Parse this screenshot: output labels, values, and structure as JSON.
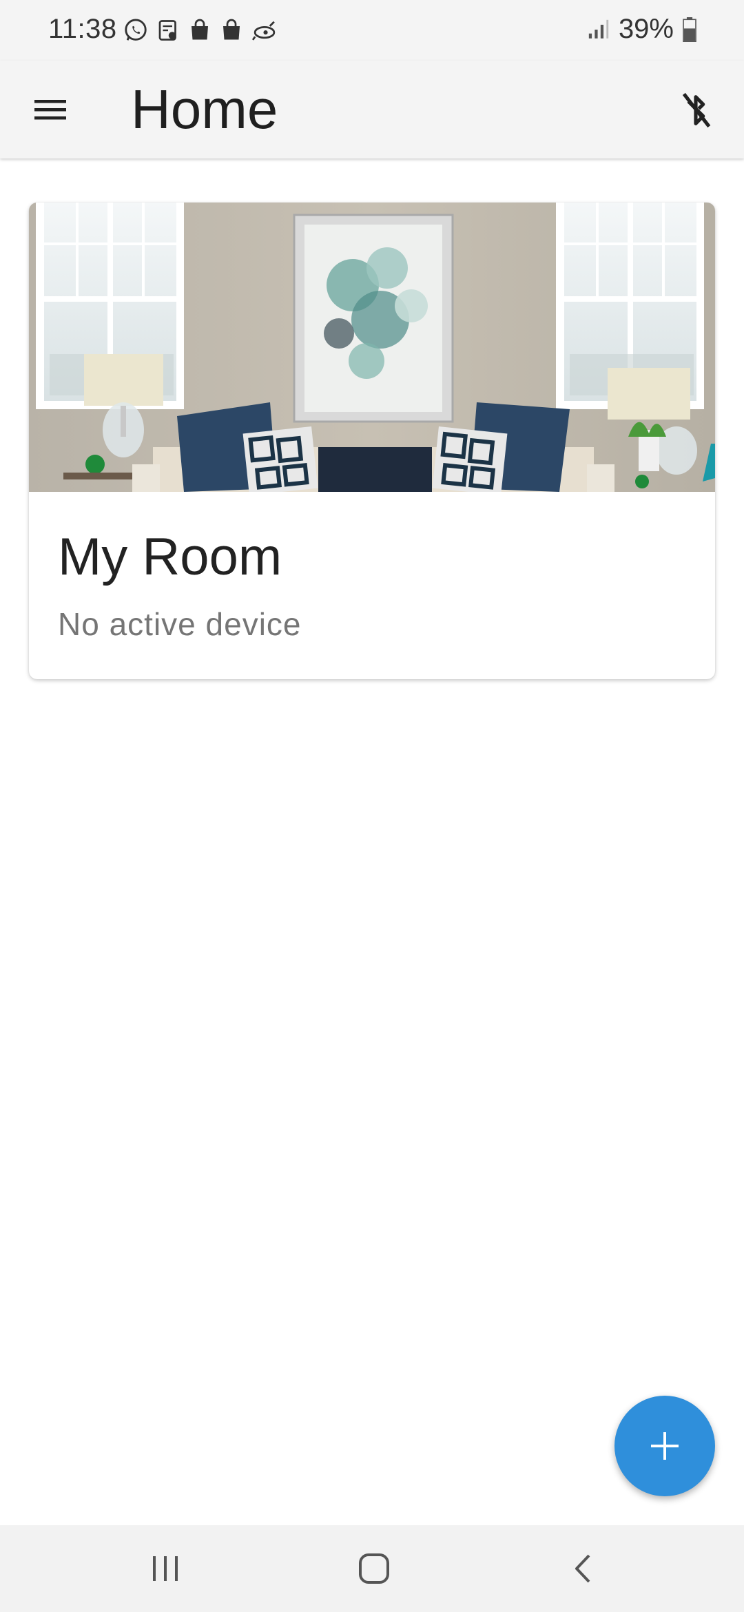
{
  "status_bar": {
    "time": "11:38",
    "notification_icons": [
      "whatsapp-icon",
      "news-icon",
      "shopping-bag-icon",
      "shopping-bag-icon",
      "rocket-icon"
    ],
    "signal_icon": "signal-icon",
    "battery_percent": "39%",
    "battery_icon": "battery-icon"
  },
  "app_bar": {
    "menu_icon": "hamburger-menu-icon",
    "title": "Home",
    "action_icon": "bluetooth-disabled-icon"
  },
  "rooms": [
    {
      "name": "My Room",
      "status": "No active device",
      "image": "living-room-photo"
    }
  ],
  "fab": {
    "icon": "plus-icon",
    "color": "#2f8fdb"
  },
  "nav_bar": {
    "items": [
      "recent-apps-icon",
      "home-icon",
      "back-icon"
    ]
  },
  "colors": {
    "app_bar_bg": "#f4f4f4",
    "accent": "#2f8fdb",
    "subtitle": "#757575"
  }
}
